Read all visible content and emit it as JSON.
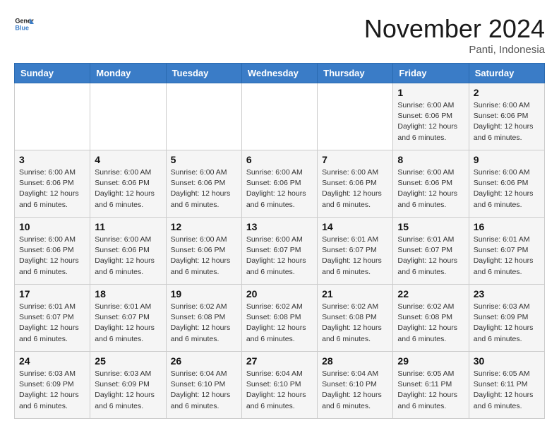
{
  "header": {
    "logo_line1": "General",
    "logo_line2": "Blue",
    "month_title": "November 2024",
    "location": "Panti, Indonesia"
  },
  "weekdays": [
    "Sunday",
    "Monday",
    "Tuesday",
    "Wednesday",
    "Thursday",
    "Friday",
    "Saturday"
  ],
  "weeks": [
    [
      {
        "day": "",
        "sunrise": "",
        "sunset": "",
        "daylight": ""
      },
      {
        "day": "",
        "sunrise": "",
        "sunset": "",
        "daylight": ""
      },
      {
        "day": "",
        "sunrise": "",
        "sunset": "",
        "daylight": ""
      },
      {
        "day": "",
        "sunrise": "",
        "sunset": "",
        "daylight": ""
      },
      {
        "day": "",
        "sunrise": "",
        "sunset": "",
        "daylight": ""
      },
      {
        "day": "1",
        "sunrise": "Sunrise: 6:00 AM",
        "sunset": "Sunset: 6:06 PM",
        "daylight": "Daylight: 12 hours and 6 minutes."
      },
      {
        "day": "2",
        "sunrise": "Sunrise: 6:00 AM",
        "sunset": "Sunset: 6:06 PM",
        "daylight": "Daylight: 12 hours and 6 minutes."
      }
    ],
    [
      {
        "day": "3",
        "sunrise": "Sunrise: 6:00 AM",
        "sunset": "Sunset: 6:06 PM",
        "daylight": "Daylight: 12 hours and 6 minutes."
      },
      {
        "day": "4",
        "sunrise": "Sunrise: 6:00 AM",
        "sunset": "Sunset: 6:06 PM",
        "daylight": "Daylight: 12 hours and 6 minutes."
      },
      {
        "day": "5",
        "sunrise": "Sunrise: 6:00 AM",
        "sunset": "Sunset: 6:06 PM",
        "daylight": "Daylight: 12 hours and 6 minutes."
      },
      {
        "day": "6",
        "sunrise": "Sunrise: 6:00 AM",
        "sunset": "Sunset: 6:06 PM",
        "daylight": "Daylight: 12 hours and 6 minutes."
      },
      {
        "day": "7",
        "sunrise": "Sunrise: 6:00 AM",
        "sunset": "Sunset: 6:06 PM",
        "daylight": "Daylight: 12 hours and 6 minutes."
      },
      {
        "day": "8",
        "sunrise": "Sunrise: 6:00 AM",
        "sunset": "Sunset: 6:06 PM",
        "daylight": "Daylight: 12 hours and 6 minutes."
      },
      {
        "day": "9",
        "sunrise": "Sunrise: 6:00 AM",
        "sunset": "Sunset: 6:06 PM",
        "daylight": "Daylight: 12 hours and 6 minutes."
      }
    ],
    [
      {
        "day": "10",
        "sunrise": "Sunrise: 6:00 AM",
        "sunset": "Sunset: 6:06 PM",
        "daylight": "Daylight: 12 hours and 6 minutes."
      },
      {
        "day": "11",
        "sunrise": "Sunrise: 6:00 AM",
        "sunset": "Sunset: 6:06 PM",
        "daylight": "Daylight: 12 hours and 6 minutes."
      },
      {
        "day": "12",
        "sunrise": "Sunrise: 6:00 AM",
        "sunset": "Sunset: 6:06 PM",
        "daylight": "Daylight: 12 hours and 6 minutes."
      },
      {
        "day": "13",
        "sunrise": "Sunrise: 6:00 AM",
        "sunset": "Sunset: 6:07 PM",
        "daylight": "Daylight: 12 hours and 6 minutes."
      },
      {
        "day": "14",
        "sunrise": "Sunrise: 6:01 AM",
        "sunset": "Sunset: 6:07 PM",
        "daylight": "Daylight: 12 hours and 6 minutes."
      },
      {
        "day": "15",
        "sunrise": "Sunrise: 6:01 AM",
        "sunset": "Sunset: 6:07 PM",
        "daylight": "Daylight: 12 hours and 6 minutes."
      },
      {
        "day": "16",
        "sunrise": "Sunrise: 6:01 AM",
        "sunset": "Sunset: 6:07 PM",
        "daylight": "Daylight: 12 hours and 6 minutes."
      }
    ],
    [
      {
        "day": "17",
        "sunrise": "Sunrise: 6:01 AM",
        "sunset": "Sunset: 6:07 PM",
        "daylight": "Daylight: 12 hours and 6 minutes."
      },
      {
        "day": "18",
        "sunrise": "Sunrise: 6:01 AM",
        "sunset": "Sunset: 6:07 PM",
        "daylight": "Daylight: 12 hours and 6 minutes."
      },
      {
        "day": "19",
        "sunrise": "Sunrise: 6:02 AM",
        "sunset": "Sunset: 6:08 PM",
        "daylight": "Daylight: 12 hours and 6 minutes."
      },
      {
        "day": "20",
        "sunrise": "Sunrise: 6:02 AM",
        "sunset": "Sunset: 6:08 PM",
        "daylight": "Daylight: 12 hours and 6 minutes."
      },
      {
        "day": "21",
        "sunrise": "Sunrise: 6:02 AM",
        "sunset": "Sunset: 6:08 PM",
        "daylight": "Daylight: 12 hours and 6 minutes."
      },
      {
        "day": "22",
        "sunrise": "Sunrise: 6:02 AM",
        "sunset": "Sunset: 6:08 PM",
        "daylight": "Daylight: 12 hours and 6 minutes."
      },
      {
        "day": "23",
        "sunrise": "Sunrise: 6:03 AM",
        "sunset": "Sunset: 6:09 PM",
        "daylight": "Daylight: 12 hours and 6 minutes."
      }
    ],
    [
      {
        "day": "24",
        "sunrise": "Sunrise: 6:03 AM",
        "sunset": "Sunset: 6:09 PM",
        "daylight": "Daylight: 12 hours and 6 minutes."
      },
      {
        "day": "25",
        "sunrise": "Sunrise: 6:03 AM",
        "sunset": "Sunset: 6:09 PM",
        "daylight": "Daylight: 12 hours and 6 minutes."
      },
      {
        "day": "26",
        "sunrise": "Sunrise: 6:04 AM",
        "sunset": "Sunset: 6:10 PM",
        "daylight": "Daylight: 12 hours and 6 minutes."
      },
      {
        "day": "27",
        "sunrise": "Sunrise: 6:04 AM",
        "sunset": "Sunset: 6:10 PM",
        "daylight": "Daylight: 12 hours and 6 minutes."
      },
      {
        "day": "28",
        "sunrise": "Sunrise: 6:04 AM",
        "sunset": "Sunset: 6:10 PM",
        "daylight": "Daylight: 12 hours and 6 minutes."
      },
      {
        "day": "29",
        "sunrise": "Sunrise: 6:05 AM",
        "sunset": "Sunset: 6:11 PM",
        "daylight": "Daylight: 12 hours and 6 minutes."
      },
      {
        "day": "30",
        "sunrise": "Sunrise: 6:05 AM",
        "sunset": "Sunset: 6:11 PM",
        "daylight": "Daylight: 12 hours and 6 minutes."
      }
    ]
  ]
}
